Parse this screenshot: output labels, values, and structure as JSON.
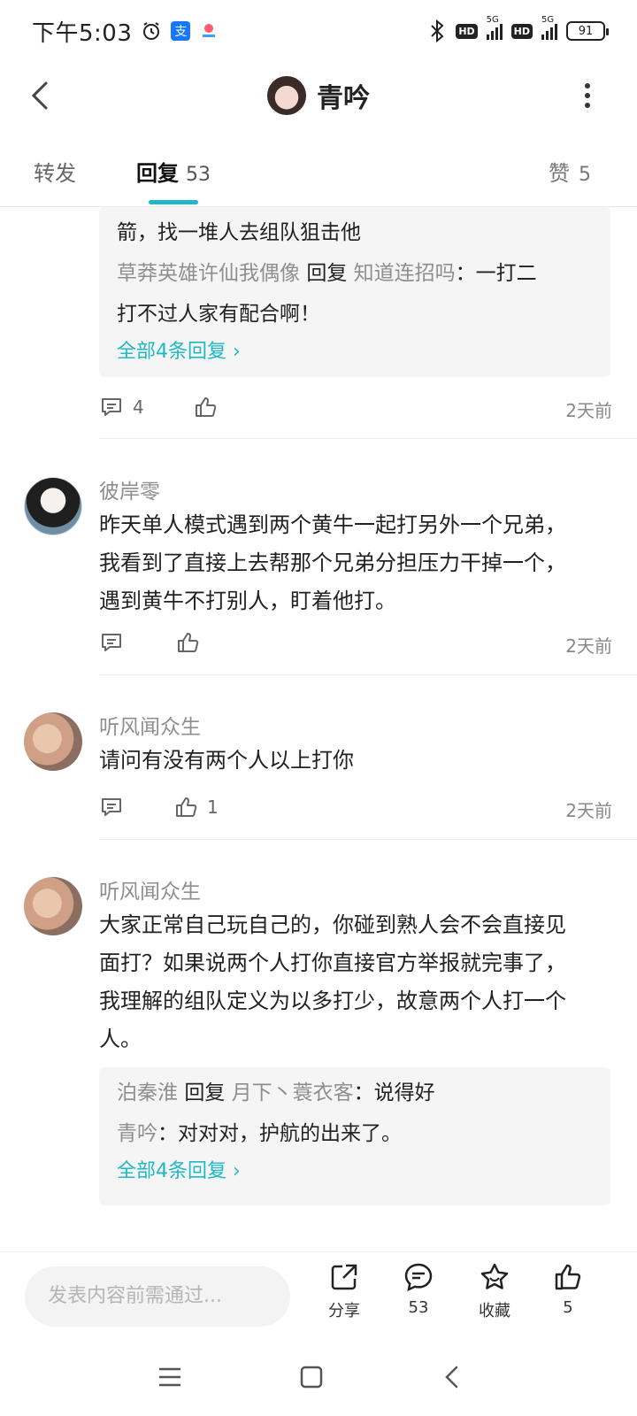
{
  "status_bar": {
    "time": "下午5:03",
    "battery": "91",
    "net1": "5G",
    "net2": "5G",
    "hd": "HD"
  },
  "header": {
    "title": "青吟"
  },
  "tabs": {
    "repost": "转发",
    "reply": "回复",
    "reply_count": "53",
    "like": "赞",
    "like_count": "5"
  },
  "thread_top": {
    "line1": "箭，找一堆人去组队狙击他",
    "reply_user": "草莽英雄许仙我偶像",
    "reply_word": "回复",
    "reply_target": "知道连招吗",
    "reply_text_a": "：一打二",
    "reply_text_b": "打不过人家有配合啊！",
    "see_all": "全部4条回复",
    "comment_count": "4",
    "time": "2天前"
  },
  "comments": [
    {
      "username": "彼岸零",
      "line1": "昨天单人模式遇到两个黄牛一起打另外一个兄弟，",
      "line2": "我看到了直接上去帮那个兄弟分担压力干掉一个，",
      "line3": "遇到黄牛不打别人，盯着他打。",
      "time": "2天前"
    },
    {
      "username": "听风闻众生",
      "line1": "请问有没有两个人以上打你",
      "like_count": "1",
      "time": "2天前"
    },
    {
      "username": "听风闻众生",
      "line1": "大家正常自己玩自己的，你碰到熟人会不会直接见",
      "line2": "面打？如果说两个人打你直接官方举报就完事了，",
      "line3": "我理解的组队定义为以多打少，故意两个人打一个",
      "line4": "人。",
      "replies": [
        {
          "user": "泊秦淮",
          "reply_word": "回复",
          "target": "月下丶蓑衣客",
          "text": "：说得好"
        },
        {
          "user": "青吟",
          "text": "：对对对，护航的出来了。"
        }
      ],
      "see_all": "全部4条回复"
    }
  ],
  "bottom_bar": {
    "input_placeholder": "发表内容前需通过...",
    "share_label": "分享",
    "comment_count": "53",
    "fav_label": "收藏",
    "like_count": "5"
  },
  "colors": {
    "accent": "#1eb8c6",
    "muted": "#8e8e8e"
  }
}
